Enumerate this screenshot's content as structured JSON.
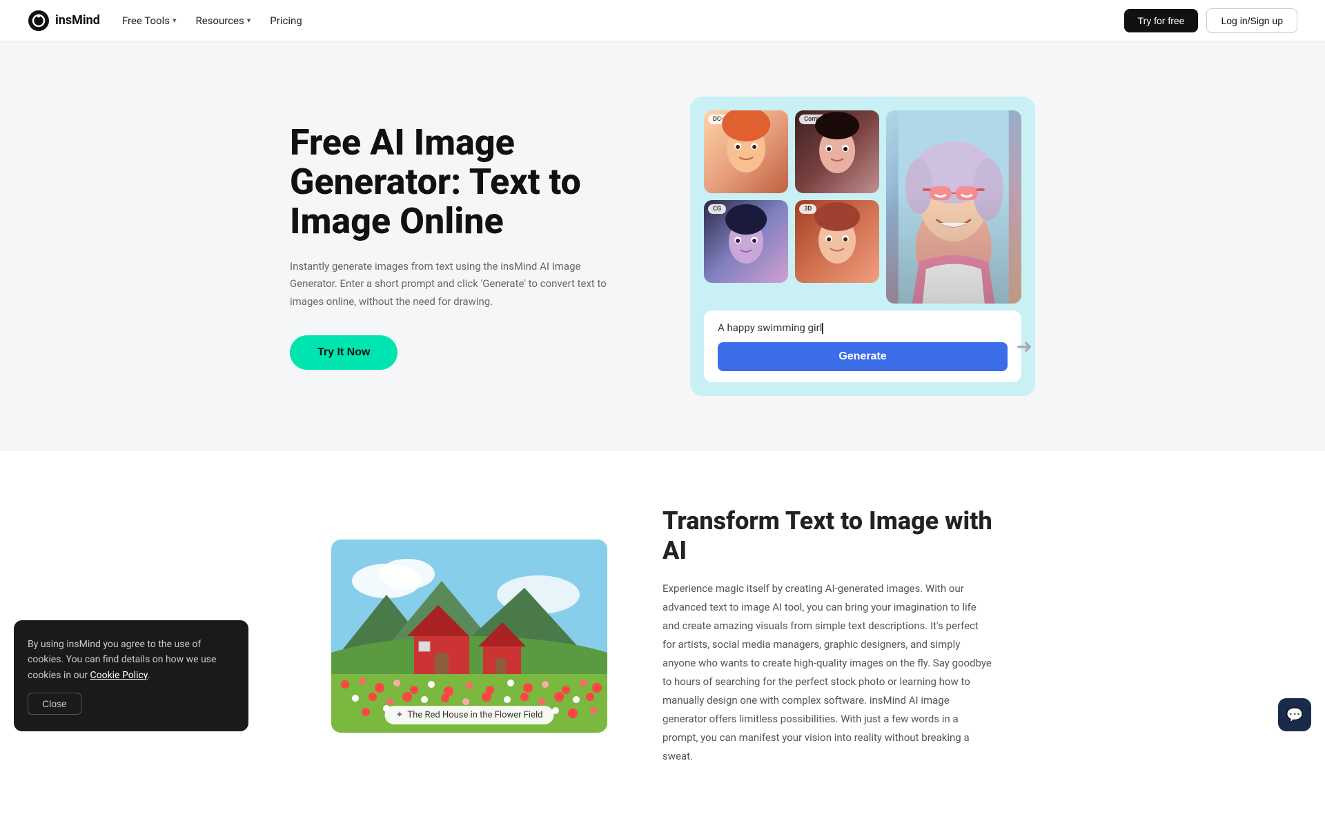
{
  "brand": {
    "name": "insMind",
    "logo_alt": "insMind logo"
  },
  "nav": {
    "free_tools_label": "Free Tools",
    "resources_label": "Resources",
    "pricing_label": "Pricing",
    "try_free_label": "Try for free",
    "login_label": "Log in/Sign up"
  },
  "hero": {
    "title": "Free AI Image Generator: Text to Image Online",
    "description": "Instantly generate images from text using the insMind AI Image Generator. Enter a short prompt and click 'Generate' to convert text to images online, without the need for drawing.",
    "cta_label": "Try It Now",
    "image_input_text": "A happy swimming girl",
    "generate_btn_label": "Generate",
    "thumbnails": [
      {
        "style": "DC-Comics"
      },
      {
        "style": "Comics"
      },
      {
        "style": "CG"
      },
      {
        "style": "3D"
      }
    ]
  },
  "section2": {
    "title": "Transform Text to Image with AI",
    "description": "Experience magic itself by creating AI-generated images. With our advanced text to image AI tool, you can bring your imagination to life and create amazing visuals from simple text descriptions. It's perfect for artists, social media managers, graphic designers, and simply anyone who wants to create high-quality images on the fly. Say goodbye to hours of searching for the perfect stock photo or learning how to manually design one with complex software. insMind AI image generator offers limitless possibilities. With just a few words in a prompt, you can manifest your vision into reality without breaking a sweat.",
    "image_caption": "The Red House in the Flower Field",
    "sparkle_icon": "✦"
  },
  "cookie": {
    "message": "By using insMind you agree to the use of cookies. You can find details on how we use cookies in our",
    "link_text": "Cookie Policy",
    "close_label": "Close"
  },
  "colors": {
    "accent_teal": "#00e5b0",
    "accent_blue": "#3b6de8",
    "dark": "#111",
    "nav_bg": "#ffffff"
  }
}
